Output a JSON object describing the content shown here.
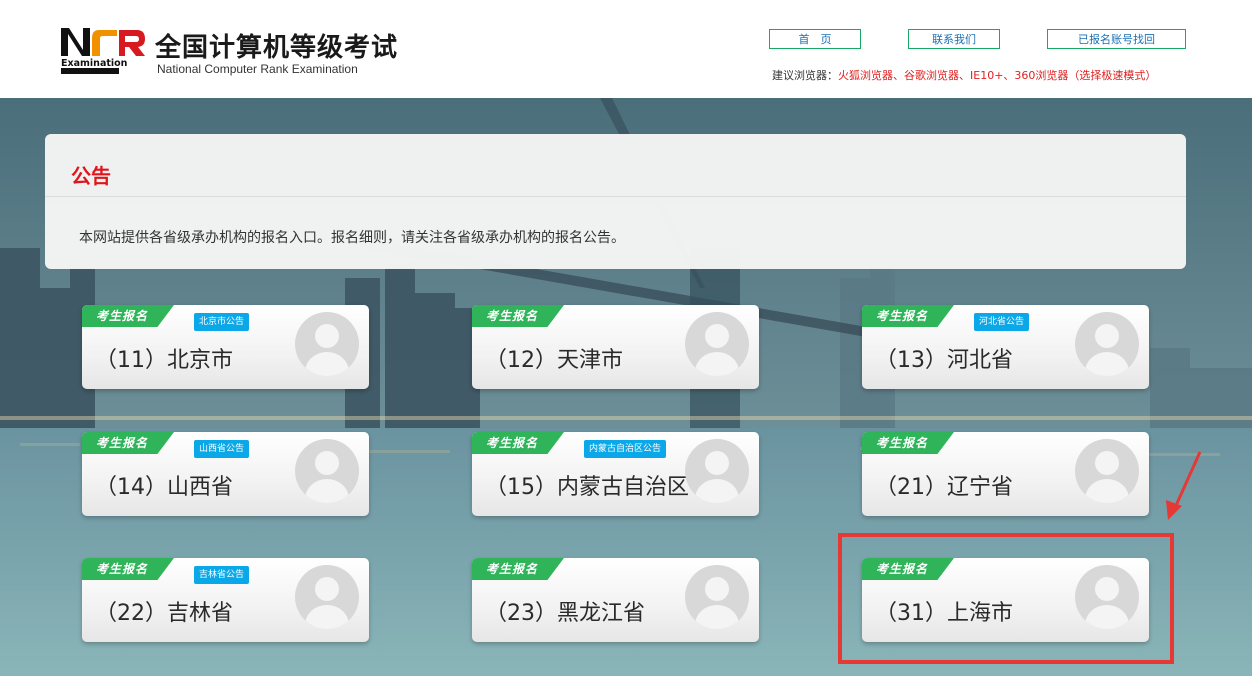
{
  "header": {
    "logo_text": "Examination",
    "title_cn": "全国计算机等级考试",
    "title_en": "National Computer Rank Examination",
    "nav": [
      {
        "label": "首　页"
      },
      {
        "label": "联系我们"
      },
      {
        "label": "已报名账号找回"
      }
    ],
    "browser_tip_label": "建议浏览器：",
    "browser_tip_value": "火狐浏览器、谷歌浏览器、IE10+、360浏览器（选择极速模式）"
  },
  "notice": {
    "title": "公告",
    "text": "本网站提供各省级承办机构的报名入口。报名细则，请关注各省级承办机构的报名公告。"
  },
  "ribbon_label": "考生报名",
  "cards": [
    {
      "name": "（11）北京市",
      "badge": "北京市公告"
    },
    {
      "name": "（12）天津市",
      "badge": ""
    },
    {
      "name": "（13）河北省",
      "badge": "河北省公告"
    },
    {
      "name": "（14）山西省",
      "badge": "山西省公告"
    },
    {
      "name": "（15）内蒙古自治区",
      "badge": "内蒙古自治区公告"
    },
    {
      "name": "（21）辽宁省",
      "badge": ""
    },
    {
      "name": "（22）吉林省",
      "badge": "吉林省公告"
    },
    {
      "name": "（23）黑龙江省",
      "badge": ""
    },
    {
      "name": "（31）上海市",
      "badge": ""
    }
  ],
  "colors": {
    "brand_green": "#2fb45a",
    "badge_blue": "#0aa8e8",
    "notice_red": "#e0141d",
    "annotation_red": "#e53935"
  }
}
